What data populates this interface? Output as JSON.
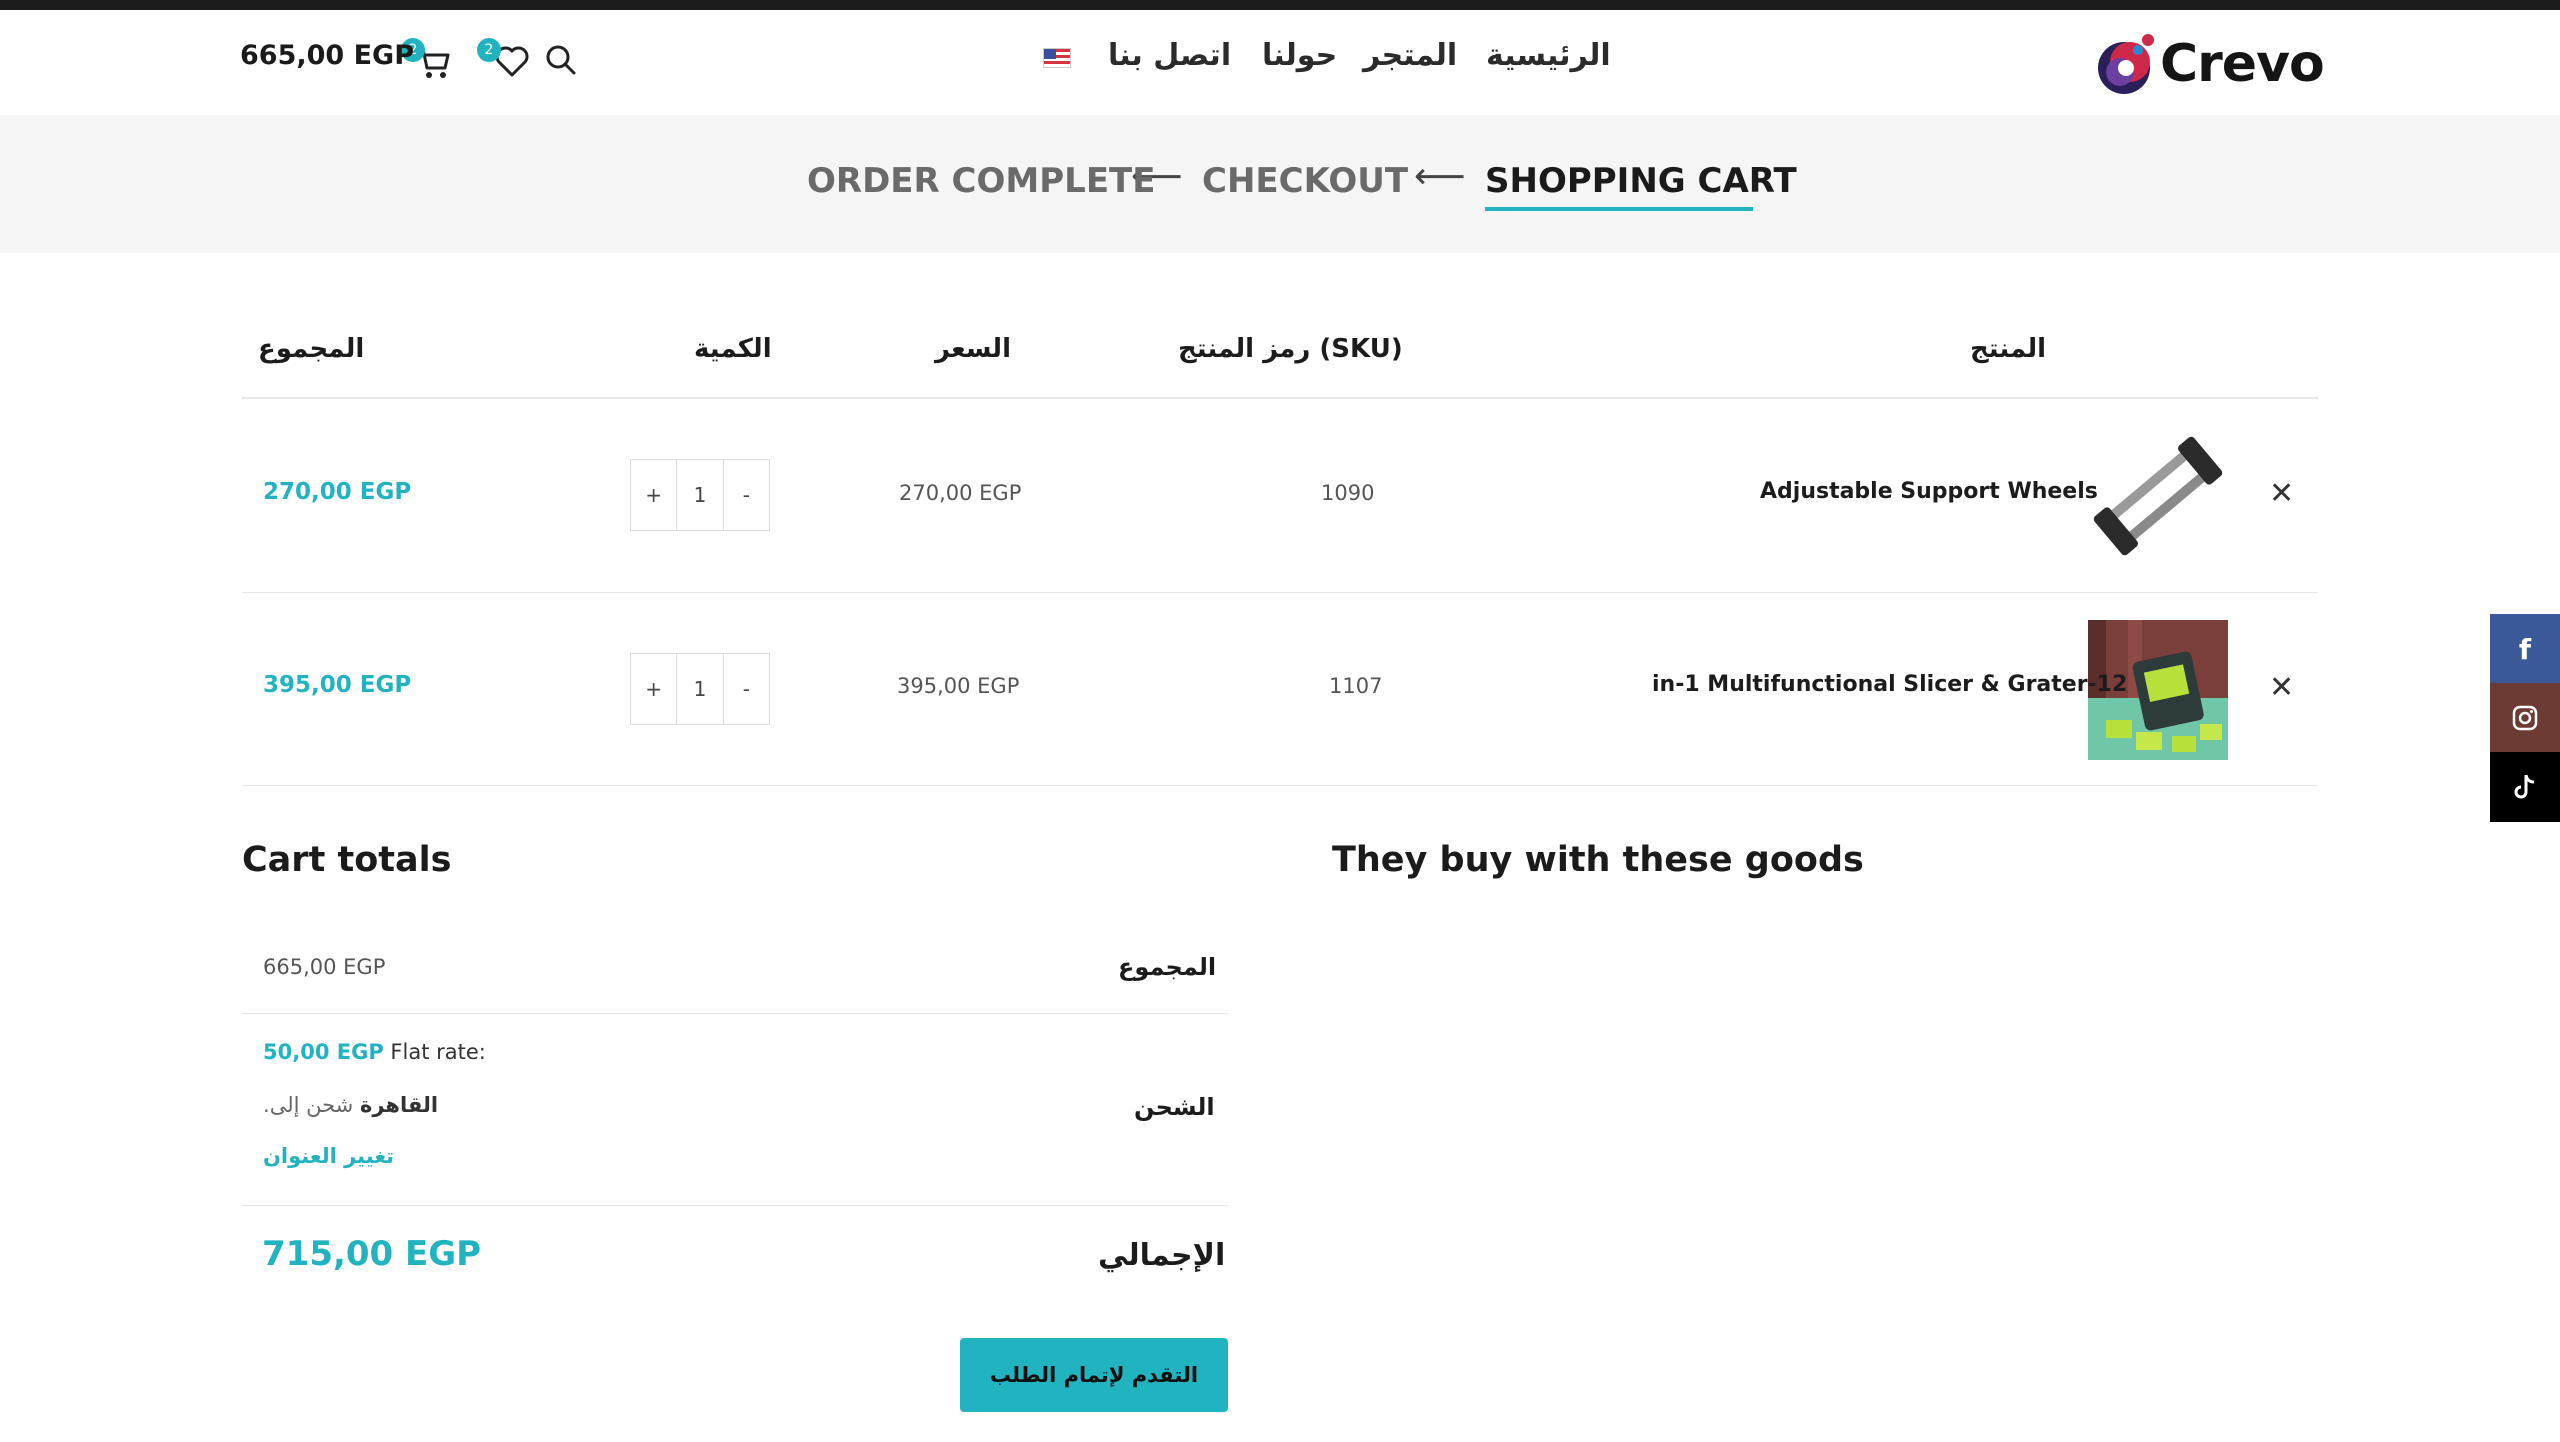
{
  "header": {
    "logo_text": "Crevo",
    "nav": [
      "الرئيسية",
      "المتجر",
      "حولنا",
      "اتصل بنا"
    ],
    "cart_amount": "665,00 EGP",
    "cart_count": "2",
    "wishlist_count": "2"
  },
  "steps": {
    "shopping_cart": "SHOPPING CART",
    "checkout": "CHECKOUT",
    "order_complete": "ORDER COMPLETE"
  },
  "table": {
    "headers": {
      "product": "المنتج",
      "sku": "رمز المنتج (SKU)",
      "price": "السعر",
      "quantity": "الكمية",
      "subtotal": "المجموع"
    },
    "rows": [
      {
        "name": "Adjustable Support Wheels",
        "sku": "1090",
        "price": "270,00 EGP",
        "qty": "1",
        "subtotal": "270,00 EGP"
      },
      {
        "name": "in-1 Multifunctional Slicer & Grater-12",
        "sku": "1107",
        "price": "395,00 EGP",
        "qty": "1",
        "subtotal": "395,00 EGP"
      }
    ],
    "plus": "+",
    "minus": "-"
  },
  "cross_sells": {
    "title": "They buy with these goods"
  },
  "totals": {
    "title": "Cart totals",
    "subtotal_label": "المجموع",
    "subtotal_value": "665,00 EGP",
    "shipping_label": "الشحن",
    "shipping_method": "Flat rate:",
    "shipping_rate": "50,00 EGP",
    "shipping_to": "شحن إلى",
    "shipping_city": "القاهرة",
    "change_address": "تغيير العنوان",
    "total_label": "الإجمالي",
    "total_value": "715,00 EGP",
    "checkout_button": "التقدم لإتمام الطلب"
  },
  "social": {
    "facebook_glyph": "f"
  }
}
